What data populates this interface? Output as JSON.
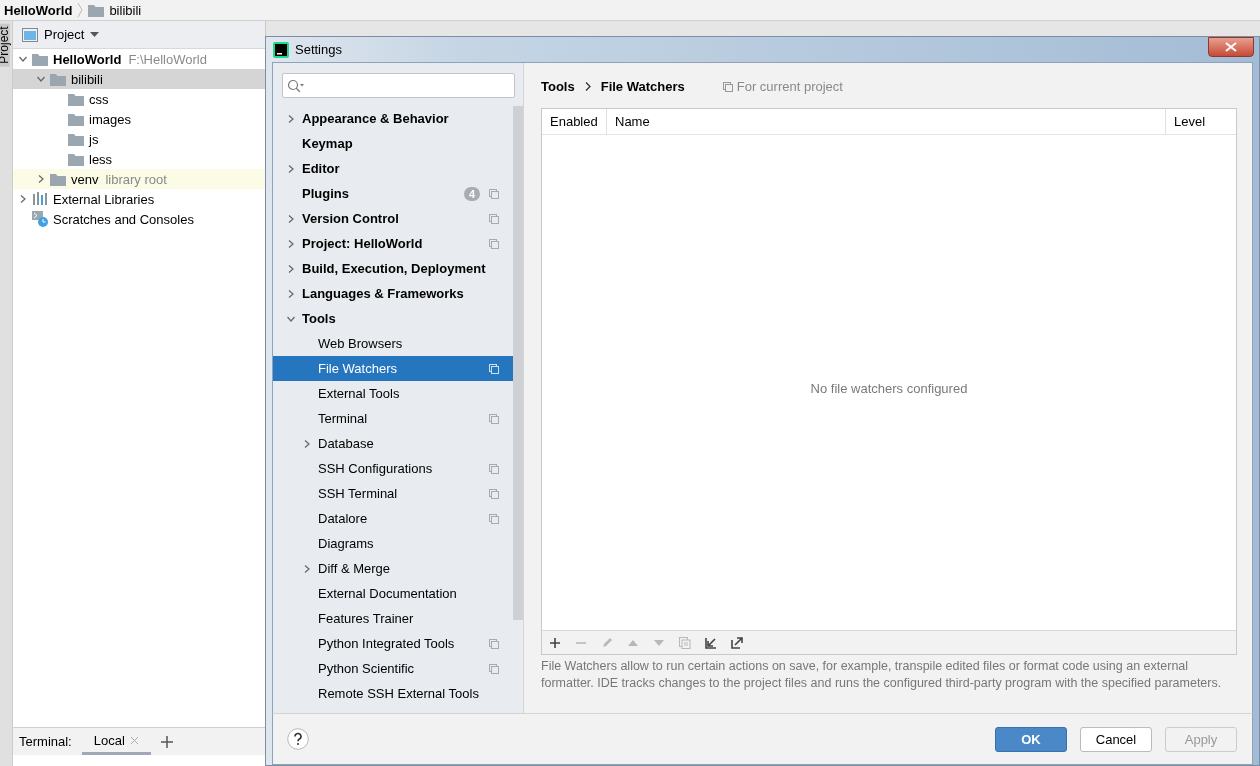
{
  "ide": {
    "breadcrumb": [
      {
        "label": "HelloWorld",
        "kind": "project"
      },
      {
        "label": "bilibili",
        "kind": "folder"
      }
    ],
    "side_stripe": {
      "label": "Project"
    },
    "project_panel": {
      "title": "Project",
      "tree": [
        {
          "label": "HelloWorld",
          "hint": "F:\\HelloWorld",
          "kind": "project",
          "expanded": true,
          "selected": false,
          "children": [
            {
              "label": "bilibili",
              "kind": "folder",
              "expanded": true,
              "selected": true,
              "children": [
                {
                  "label": "css",
                  "kind": "folder",
                  "selected": false
                },
                {
                  "label": "images",
                  "kind": "folder",
                  "selected": false
                },
                {
                  "label": "js",
                  "kind": "folder",
                  "selected": false
                },
                {
                  "label": "less",
                  "kind": "folder",
                  "selected": false
                }
              ]
            },
            {
              "label": "venv",
              "hint": "library root",
              "kind": "library",
              "expanded": false,
              "selected": false
            }
          ]
        },
        {
          "label": "External Libraries",
          "kind": "libraries",
          "expanded": false,
          "selected": false
        },
        {
          "label": "Scratches and Consoles",
          "kind": "scratches",
          "selected": false
        }
      ]
    },
    "terminal": {
      "label": "Terminal:",
      "tabs": [
        {
          "label": "Local",
          "selected": true
        }
      ]
    }
  },
  "dialog": {
    "title": "Settings",
    "nav": [
      {
        "label": "Appearance & Behavior",
        "kind": "group",
        "expanded": false,
        "selected": false,
        "project_scope": false
      },
      {
        "label": "Keymap",
        "kind": "leaf",
        "selected": false,
        "project_scope": false
      },
      {
        "label": "Editor",
        "kind": "group",
        "expanded": false,
        "selected": false,
        "project_scope": false
      },
      {
        "label": "Plugins",
        "kind": "leaf",
        "badge": "4",
        "selected": false,
        "project_scope": true
      },
      {
        "label": "Version Control",
        "kind": "group",
        "expanded": false,
        "selected": false,
        "project_scope": true
      },
      {
        "label": "Project: HelloWorld",
        "kind": "group",
        "expanded": false,
        "selected": false,
        "project_scope": true
      },
      {
        "label": "Build, Execution, Deployment",
        "kind": "group",
        "expanded": false,
        "selected": false,
        "project_scope": false
      },
      {
        "label": "Languages & Frameworks",
        "kind": "group",
        "expanded": false,
        "selected": false,
        "project_scope": false
      },
      {
        "label": "Tools",
        "kind": "group",
        "expanded": true,
        "selected": false,
        "project_scope": false,
        "children": [
          {
            "label": "Web Browsers",
            "kind": "leaf",
            "selected": false,
            "project_scope": false
          },
          {
            "label": "File Watchers",
            "kind": "leaf",
            "selected": true,
            "project_scope": true
          },
          {
            "label": "External Tools",
            "kind": "leaf",
            "selected": false,
            "project_scope": false
          },
          {
            "label": "Terminal",
            "kind": "leaf",
            "selected": false,
            "project_scope": true
          },
          {
            "label": "Database",
            "kind": "group",
            "expanded": false,
            "selected": false,
            "project_scope": false
          },
          {
            "label": "SSH Configurations",
            "kind": "leaf",
            "selected": false,
            "project_scope": true
          },
          {
            "label": "SSH Terminal",
            "kind": "leaf",
            "selected": false,
            "project_scope": true
          },
          {
            "label": "Datalore",
            "kind": "leaf",
            "selected": false,
            "project_scope": true
          },
          {
            "label": "Diagrams",
            "kind": "leaf",
            "selected": false,
            "project_scope": false
          },
          {
            "label": "Diff & Merge",
            "kind": "group",
            "expanded": false,
            "selected": false,
            "project_scope": false
          },
          {
            "label": "External Documentation",
            "kind": "leaf",
            "selected": false,
            "project_scope": false
          },
          {
            "label": "Features Trainer",
            "kind": "leaf",
            "selected": false,
            "project_scope": false
          },
          {
            "label": "Python Integrated Tools",
            "kind": "leaf",
            "selected": false,
            "project_scope": true
          },
          {
            "label": "Python Scientific",
            "kind": "leaf",
            "selected": false,
            "project_scope": true
          },
          {
            "label": "Remote SSH External Tools",
            "kind": "leaf",
            "selected": false,
            "project_scope": false
          }
        ]
      }
    ],
    "breadcrumb": [
      "Tools",
      "File Watchers"
    ],
    "scope_note": "For current project",
    "table": {
      "columns": [
        "Enabled",
        "Name",
        "Level"
      ],
      "empty_text": "No file watchers configured"
    },
    "toolbar": [
      {
        "kind": "add",
        "disabled": false
      },
      {
        "kind": "remove",
        "disabled": true
      },
      {
        "kind": "edit",
        "disabled": true
      },
      {
        "kind": "up",
        "disabled": true
      },
      {
        "kind": "down",
        "disabled": true
      },
      {
        "kind": "copy",
        "disabled": true
      },
      {
        "kind": "import",
        "disabled": false
      },
      {
        "kind": "export",
        "disabled": false
      }
    ],
    "description": "File Watchers allow to run certain actions on save, for example, transpile edited files or format code using an external formatter. IDE tracks changes to the project files and runs the configured third-party program with the specified parameters.",
    "buttons": [
      {
        "label": "OK",
        "kind": "primary",
        "disabled": false
      },
      {
        "label": "Cancel",
        "kind": "normal",
        "disabled": false
      },
      {
        "label": "Apply",
        "kind": "normal",
        "disabled": true
      }
    ]
  }
}
